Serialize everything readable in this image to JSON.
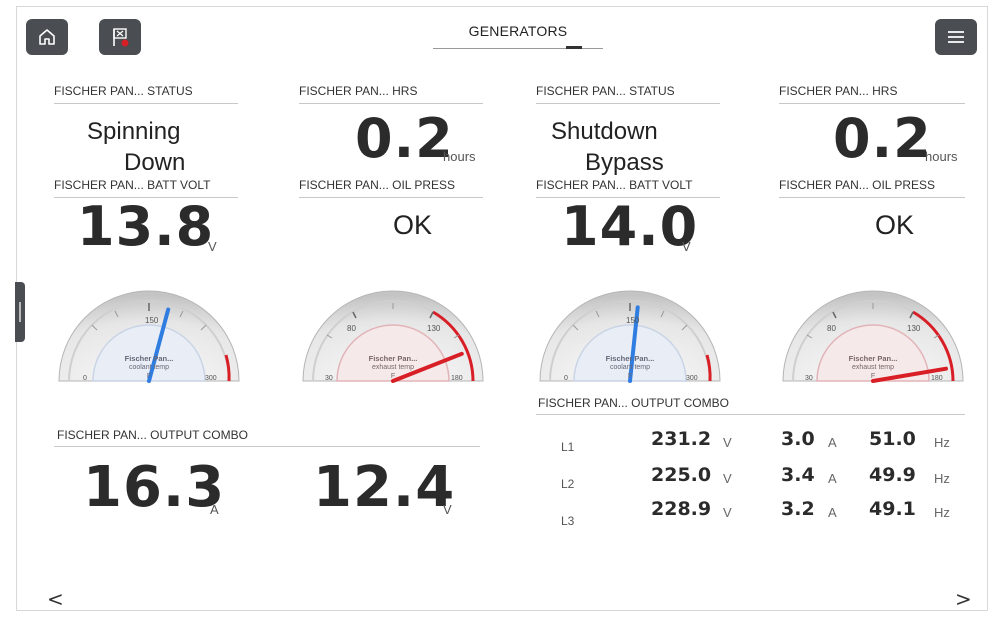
{
  "header": {
    "title": "GENERATORS",
    "home_icon": "home-icon",
    "alarm_icon": "alarm-flag-icon",
    "menu_icon": "menu-icon"
  },
  "gen1": {
    "status_label": "FISCHER PAN... STATUS",
    "status_line1": "Spinning",
    "status_line2": "Down",
    "hrs_label": "FISCHER PAN... HRS",
    "hrs_value": "0.2",
    "hrs_unit": "hours",
    "batt_label": "FISCHER PAN... BATT VOLT",
    "batt_value": "13.8",
    "batt_unit": "V",
    "oil_label": "FISCHER PAN... OIL PRESS",
    "oil_value": "OK",
    "coolant_gauge": {
      "name_line1": "Fischer Pan...",
      "name_line2": "coolant temp",
      "unit": "F",
      "min_label": "0",
      "mid_label": "150",
      "max_label": "300",
      "min": 0,
      "max": 300,
      "value": 175
    },
    "exhaust_gauge": {
      "name_line1": "Fischer Pan...",
      "name_line2": "exhaust temp",
      "unit": "F",
      "min_label": "30",
      "low_label": "80",
      "high_label": "130",
      "max_label": "180",
      "min": 30,
      "max": 180,
      "value": 162
    },
    "output_label": "FISCHER PAN... OUTPUT COMBO",
    "current_value": "16.3",
    "current_unit": "A",
    "voltage_value": "12.4",
    "voltage_unit": "V"
  },
  "gen2": {
    "status_label": "FISCHER PAN... STATUS",
    "status_line1": "Shutdown",
    "status_line2": "Bypass",
    "hrs_label": "FISCHER PAN... HRS",
    "hrs_value": "0.2",
    "hrs_unit": "hours",
    "batt_label": "FISCHER PAN... BATT VOLT",
    "batt_value": "14.0",
    "batt_unit": "V",
    "oil_label": "FISCHER PAN... OIL PRESS",
    "oil_value": "OK",
    "coolant_gauge": {
      "name_line1": "Fischer Pan...",
      "name_line2": "coolant temp",
      "unit": "F",
      "min_label": "0",
      "mid_label": "150",
      "max_label": "300",
      "min": 0,
      "max": 300,
      "value": 160
    },
    "exhaust_gauge": {
      "name_line1": "Fischer Pan...",
      "name_line2": "exhaust temp",
      "unit": "F",
      "min_label": "30",
      "low_label": "80",
      "high_label": "130",
      "max_label": "180",
      "min": 30,
      "max": 180,
      "value": 172
    },
    "output_label": "FISCHER PAN... OUTPUT COMBO",
    "phases": [
      {
        "name": "L1",
        "volts": "231.2",
        "volts_unit": "V",
        "amps": "3.0",
        "amps_unit": "A",
        "hz": "51.0",
        "hz_unit": "Hz"
      },
      {
        "name": "L2",
        "volts": "225.0",
        "volts_unit": "V",
        "amps": "3.4",
        "amps_unit": "A",
        "hz": "49.9",
        "hz_unit": "Hz"
      },
      {
        "name": "L3",
        "volts": "228.9",
        "volts_unit": "V",
        "amps": "3.2",
        "amps_unit": "A",
        "hz": "49.1",
        "hz_unit": "Hz"
      }
    ]
  },
  "nav": {
    "prev": "<",
    "next": ">"
  },
  "colors": {
    "accent_blue": "#2f7de1",
    "alarm_red": "#d81f26",
    "button_dark": "#4a4d51"
  }
}
